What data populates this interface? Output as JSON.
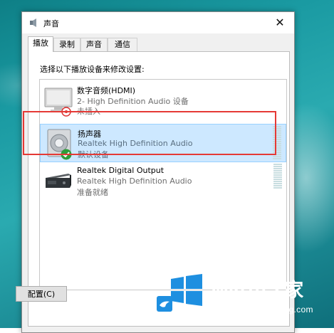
{
  "window": {
    "title": "声音",
    "close_glyph": "✕",
    "title_icon": "speaker-icon"
  },
  "tabs": [
    {
      "label": "播放",
      "active": true
    },
    {
      "label": "录制",
      "active": false
    },
    {
      "label": "声音",
      "active": false
    },
    {
      "label": "通信",
      "active": false
    }
  ],
  "playback": {
    "instruction": "选择以下播放设备来修改设置:",
    "devices": [
      {
        "name": "数字音频(HDMI)",
        "description": "2- High Definition Audio 设备",
        "status": "未插入",
        "icon": "monitor-icon",
        "badge": "disconnected-badge-icon",
        "selected": false
      },
      {
        "name": "扬声器",
        "description": "Realtek High Definition Audio",
        "status": "默认设备",
        "icon": "speaker-icon",
        "badge": "default-check-icon",
        "selected": true
      },
      {
        "name": "Realtek Digital Output",
        "description": "Realtek High Definition Audio",
        "status": "准备就绪",
        "icon": "digital-output-icon",
        "selected": false
      }
    ],
    "configure_button": "配置(C)"
  },
  "watermark": {
    "title": "Win10之家",
    "url": "www.win10xitong.com"
  },
  "colors": {
    "selection_bg": "#cde8ff",
    "selection_border": "#99d1ff",
    "highlight_box": "#e53935",
    "check_green": "#2e9d3a"
  }
}
